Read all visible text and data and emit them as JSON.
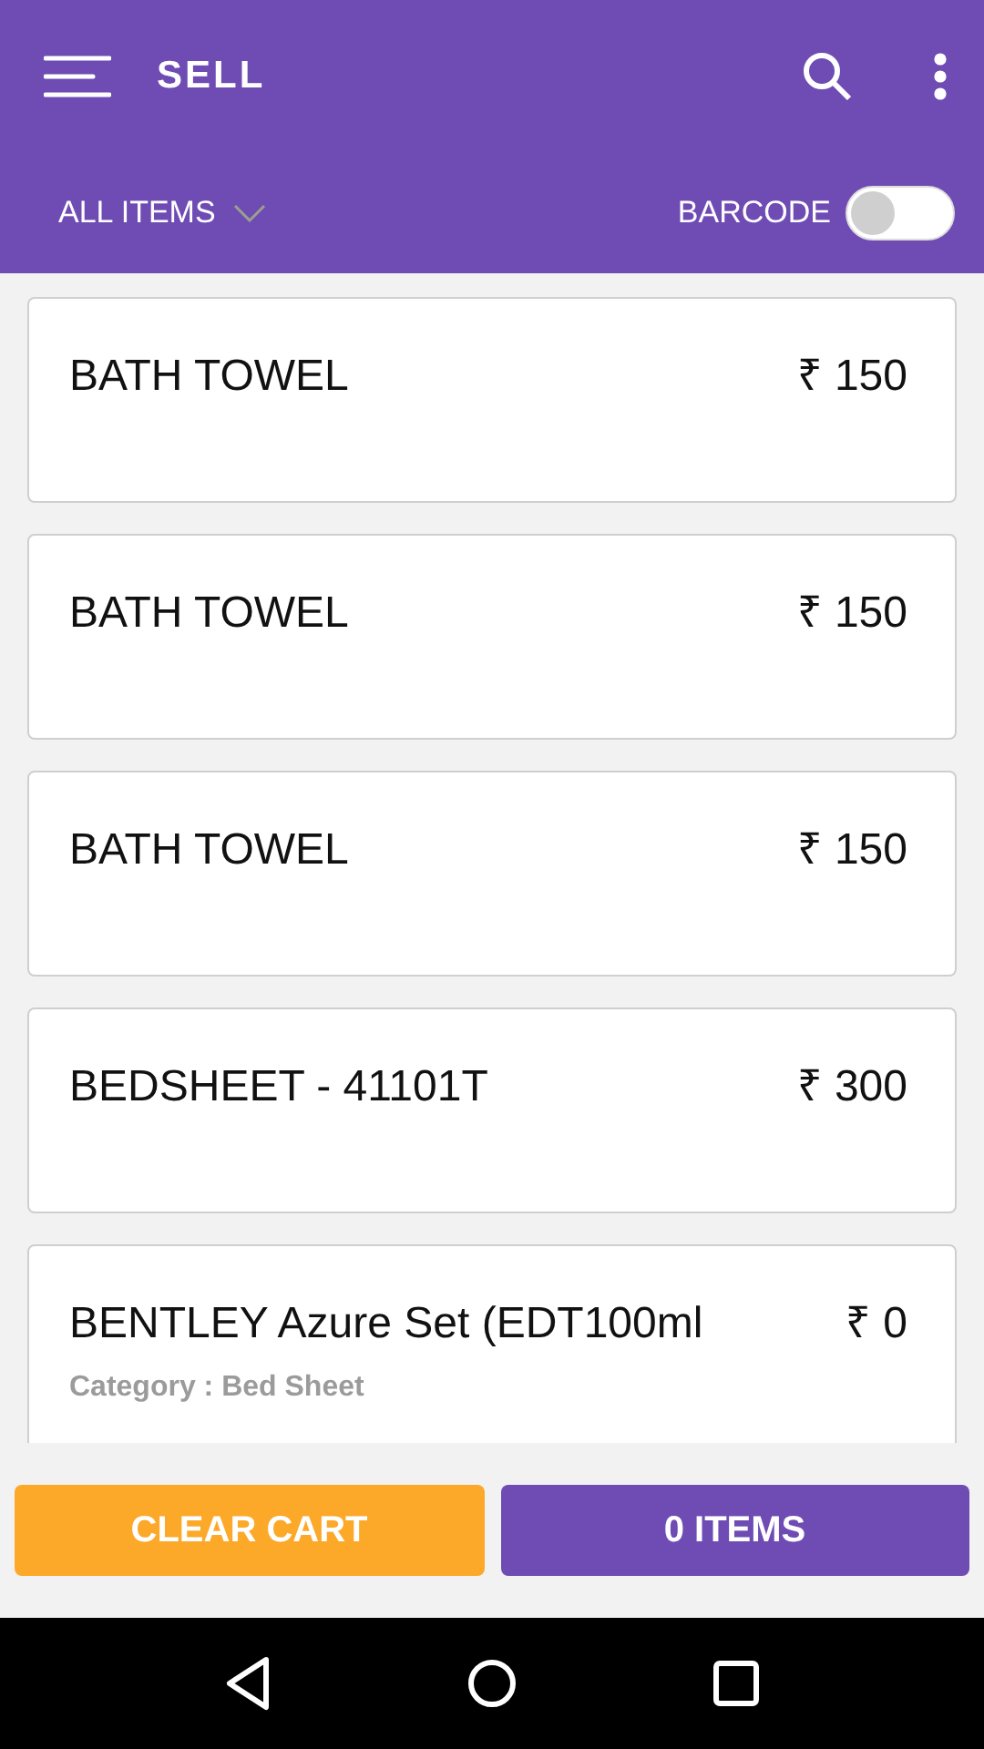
{
  "app_bar": {
    "title": "SELL"
  },
  "filter": {
    "label": "ALL ITEMS"
  },
  "barcode": {
    "label": "BARCODE",
    "on": false
  },
  "items": [
    {
      "name": "BATH TOWEL",
      "price": "₹ 150"
    },
    {
      "name": "BATH TOWEL",
      "price": "₹ 150"
    },
    {
      "name": "BATH TOWEL",
      "price": "₹ 150"
    },
    {
      "name": "BEDSHEET - 41101T",
      "price": "₹ 300"
    },
    {
      "name": "BENTLEY Azure Set (EDT100ml",
      "price": "₹ 0",
      "category": "Category : Bed Sheet"
    }
  ],
  "buttons": [
    {
      "kind": "clear",
      "label": "CLEAR CART"
    },
    {
      "kind": "cart",
      "label": "0 ITEMS"
    }
  ]
}
